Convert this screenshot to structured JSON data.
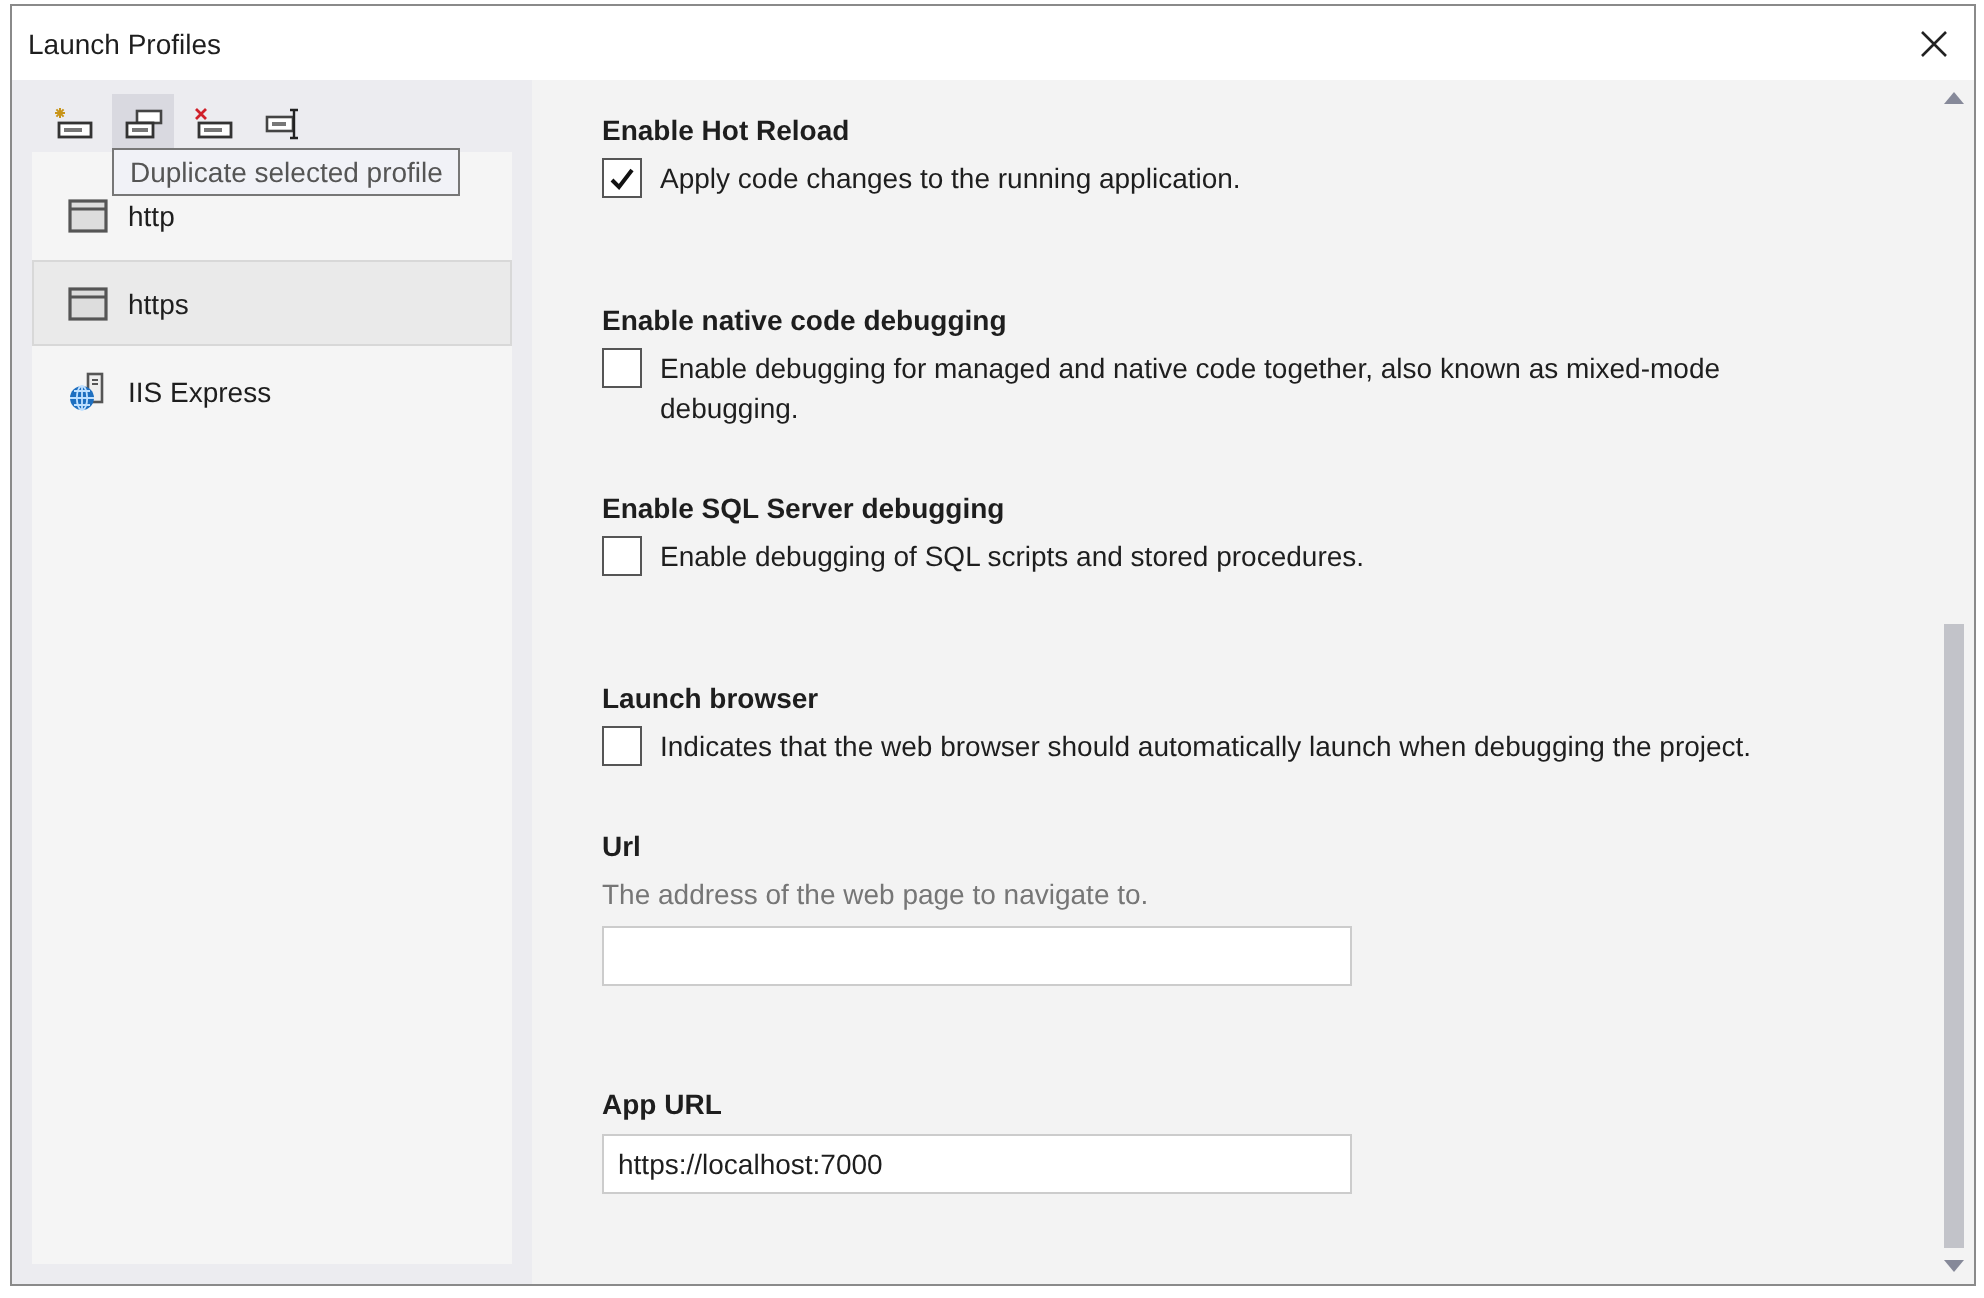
{
  "window": {
    "title": "Launch Profiles"
  },
  "toolbar": [
    {
      "kind": "new",
      "hovered": false
    },
    {
      "kind": "duplicate",
      "hovered": true
    },
    {
      "kind": "delete",
      "hovered": false
    },
    {
      "kind": "rename",
      "hovered": false
    }
  ],
  "tooltip": "Duplicate selected profile",
  "profiles": [
    {
      "label": "http",
      "kind": "web",
      "selected": false
    },
    {
      "label": "https",
      "kind": "web",
      "selected": true
    },
    {
      "label": "IIS Express",
      "kind": "iis",
      "selected": false
    }
  ],
  "settings": [
    {
      "kind": "checkbox",
      "title": "Enable Hot Reload",
      "label": "Apply code changes to the running application.",
      "checked": true
    },
    {
      "kind": "checkbox",
      "title": "Enable native code debugging",
      "label": "Enable debugging for managed and native code together, also known as mixed-mode debugging.",
      "checked": false
    },
    {
      "kind": "checkbox",
      "title": "Enable SQL Server debugging",
      "label": "Enable debugging of SQL scripts and stored procedures.",
      "checked": false
    },
    {
      "kind": "checkbox",
      "title": "Launch browser",
      "label": "Indicates that the web browser should automatically launch when debugging the project.",
      "checked": false
    },
    {
      "kind": "text",
      "title": "Url",
      "description": "The address of the web page to navigate to."
    },
    {
      "kind": "text",
      "title": "App URL",
      "value": "https://localhost:7000"
    }
  ]
}
